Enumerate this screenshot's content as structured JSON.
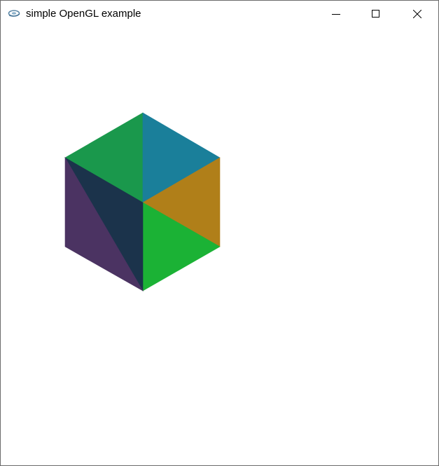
{
  "window": {
    "title": "simple OpenGL example",
    "app_icon": "opengl-app-icon",
    "controls": {
      "minimize_icon": "minimize-icon",
      "maximize_icon": "maximize-icon",
      "close_icon": "close-icon"
    }
  },
  "scene": {
    "object": "cube",
    "background_color": "#ffffff",
    "face_colors": {
      "top_left": "#1a984c",
      "top_right": "#1a7f9a",
      "right_upper": "#b07f19",
      "right_lower": "#1bb235",
      "left_inner": "#1b334b",
      "left_outer": "#4b3362"
    }
  }
}
